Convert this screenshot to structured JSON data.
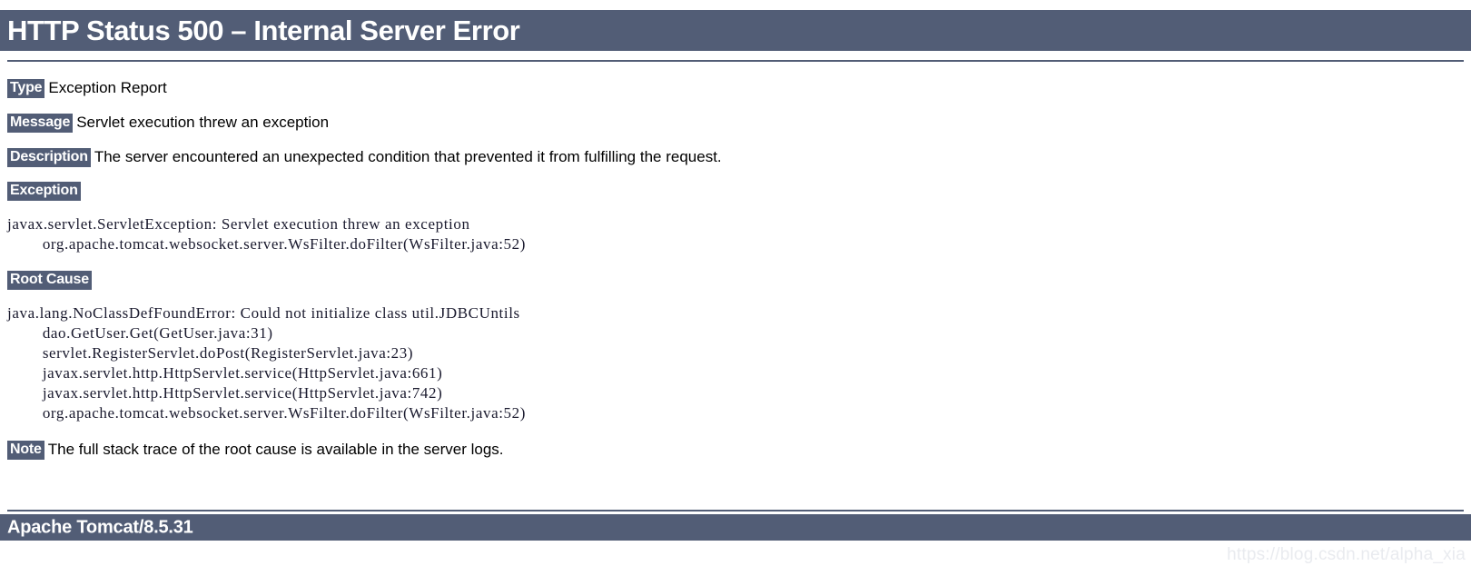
{
  "header": {
    "title": "HTTP Status 500 – Internal Server Error"
  },
  "report": {
    "type_label": "Type",
    "type_value": "Exception Report",
    "message_label": "Message",
    "message_value": "Servlet execution threw an exception",
    "description_label": "Description",
    "description_value": "The server encountered an unexpected condition that prevented it from fulfilling the request.",
    "exception_label": "Exception",
    "exception_trace": "javax.servlet.ServletException: Servlet execution threw an exception\n\torg.apache.tomcat.websocket.server.WsFilter.doFilter(WsFilter.java:52)",
    "root_cause_label": "Root Cause",
    "root_cause_trace": "java.lang.NoClassDefFoundError: Could not initialize class util.JDBCUntils\n\tdao.GetUser.Get(GetUser.java:31)\n\tservlet.RegisterServlet.doPost(RegisterServlet.java:23)\n\tjavax.servlet.http.HttpServlet.service(HttpServlet.java:661)\n\tjavax.servlet.http.HttpServlet.service(HttpServlet.java:742)\n\torg.apache.tomcat.websocket.server.WsFilter.doFilter(WsFilter.java:52)",
    "note_label": "Note",
    "note_value": "The full stack trace of the root cause is available in the server logs."
  },
  "footer": {
    "server": "Apache Tomcat/8.5.31"
  },
  "watermark": {
    "text": "https://blog.csdn.net/alpha_xia"
  },
  "colors": {
    "band": "#525D76",
    "band_text": "#ffffff",
    "body_text": "#000000",
    "trace_text": "#1a1a2e",
    "watermark": "#e8eaef"
  }
}
